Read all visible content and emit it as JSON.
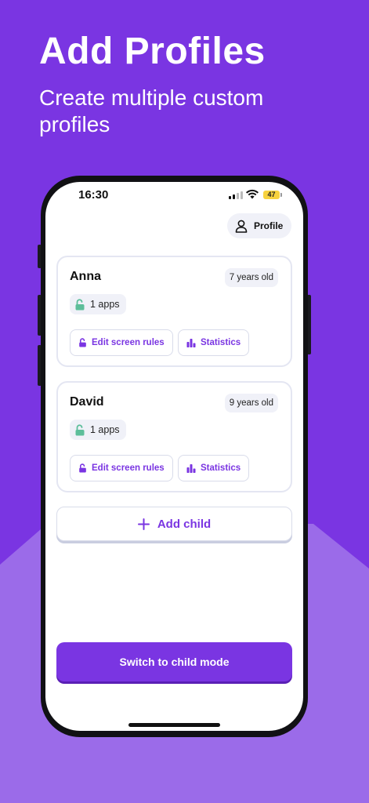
{
  "header": {
    "title": "Add Profiles",
    "subtitle": "Create multiple custom profiles"
  },
  "status_bar": {
    "time": "16:30",
    "battery": "47"
  },
  "profile_button": {
    "label": "Profile",
    "icon": "person-icon"
  },
  "children": [
    {
      "name": "Anna",
      "age": "7 years old",
      "apps": "1 apps",
      "edit_label": "Edit screen rules",
      "stats_label": "Statistics"
    },
    {
      "name": "David",
      "age": "9 years old",
      "apps": "1 apps",
      "edit_label": "Edit screen rules",
      "stats_label": "Statistics"
    }
  ],
  "add_child": {
    "label": "Add child",
    "icon": "plus-icon"
  },
  "switch_mode": {
    "label": "Switch to child mode"
  },
  "colors": {
    "accent": "#7A35E2",
    "background_top": "#7A35E2",
    "background_bottom": "#9B6BE9",
    "unlock_icon": "#5DBE9A"
  }
}
